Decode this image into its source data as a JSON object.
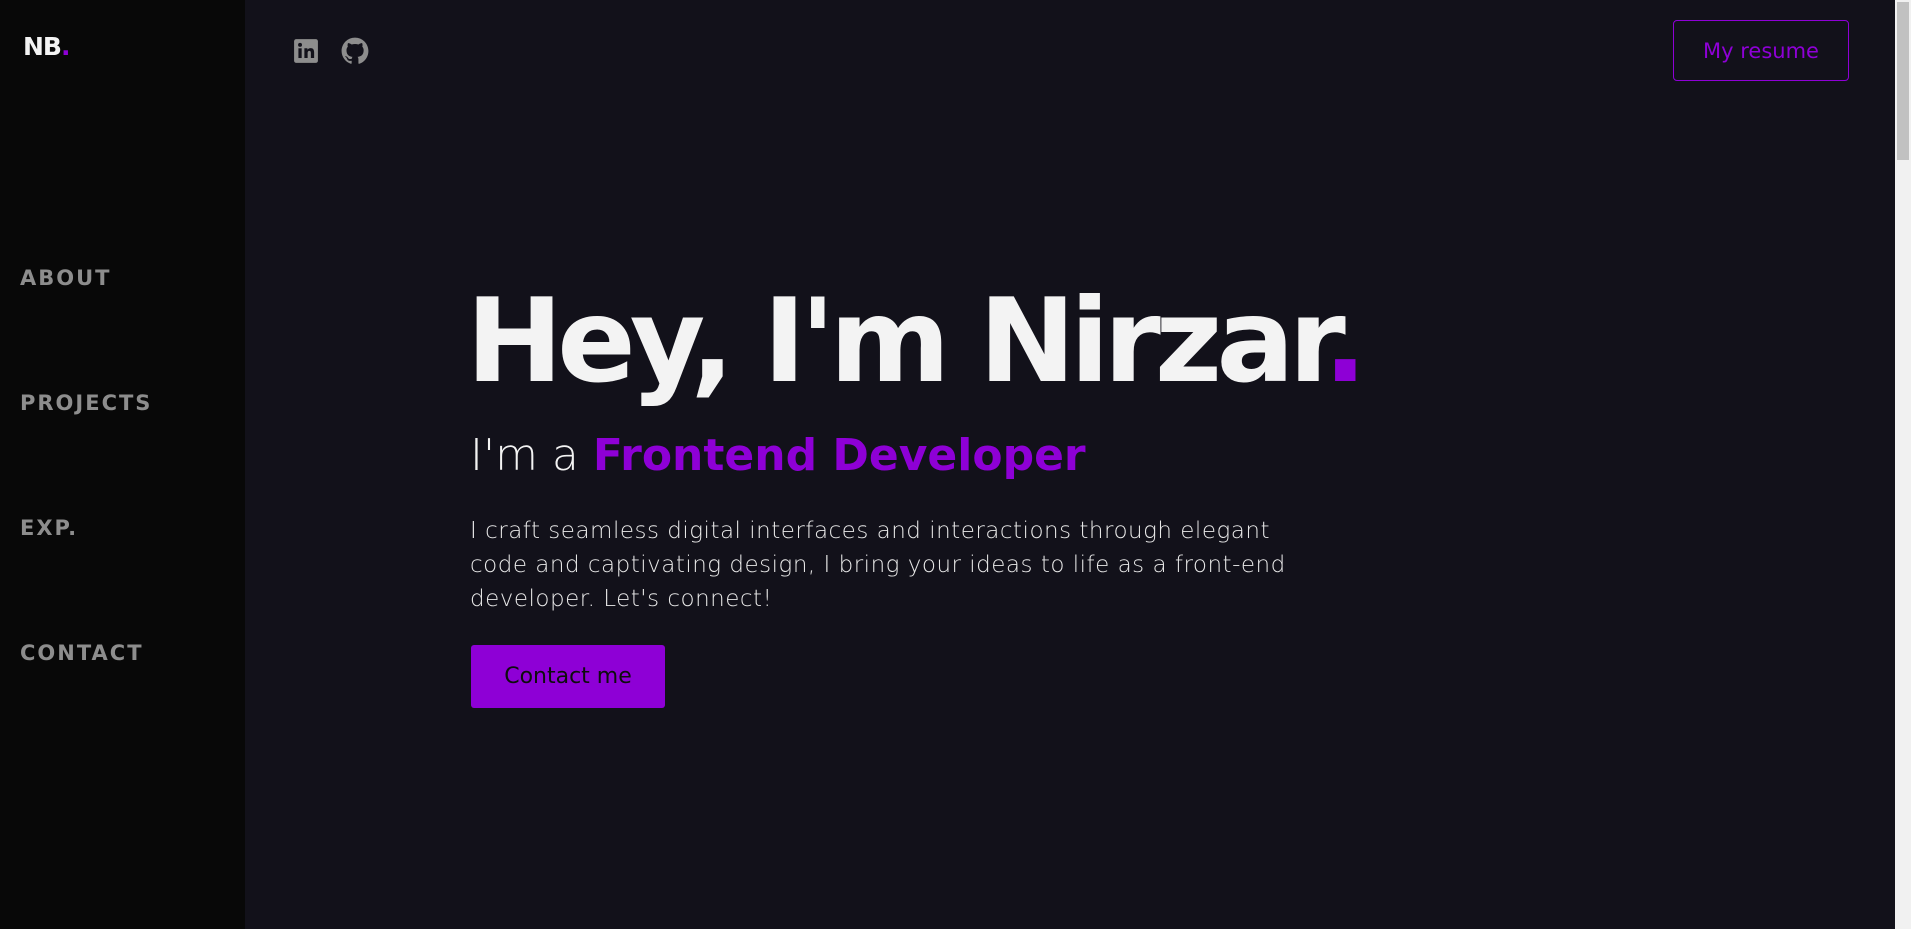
{
  "brand": {
    "logo_text": "NB",
    "logo_dot": ".",
    "accent_color": "#8e00d6"
  },
  "sidebar": {
    "items": [
      {
        "label": "ABOUT"
      },
      {
        "label": "PROJECTS"
      },
      {
        "label": "EXP."
      },
      {
        "label": "CONTACT"
      }
    ]
  },
  "header": {
    "social": [
      {
        "icon": "linkedin-icon"
      },
      {
        "icon": "github-icon"
      }
    ],
    "resume_label": "My resume"
  },
  "hero": {
    "title": "Hey, I'm Nirzar",
    "title_dot": ".",
    "subtitle_prefix": "I'm a ",
    "subtitle_role": "Frontend Developer",
    "description": "I craft seamless digital interfaces and interactions through elegant code and captivating design, I bring your ideas to life as a front-end developer. Let's connect!",
    "cta_label": "Contact me"
  }
}
